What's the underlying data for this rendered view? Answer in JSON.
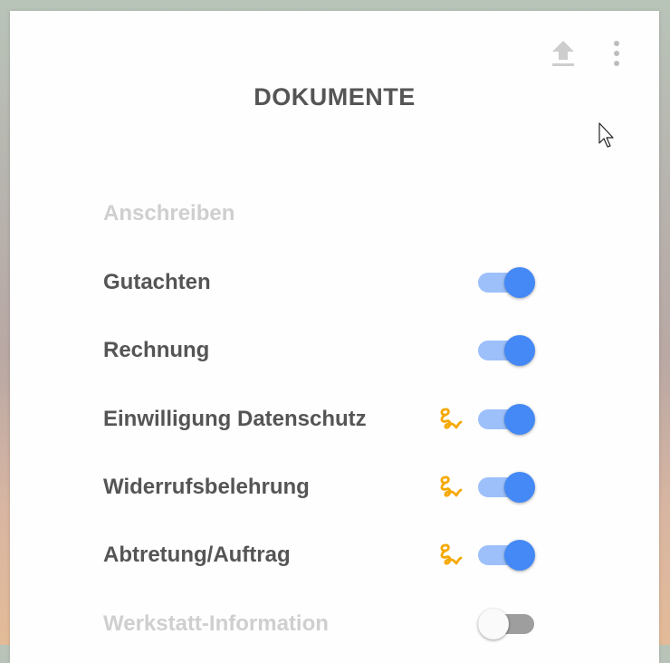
{
  "header": {
    "title": "DOKUMENTE",
    "upload_icon": "upload-icon",
    "menu_icon": "more-vert-icon"
  },
  "colors": {
    "accent": "#4489f6",
    "accent_track": "#9dc0fb",
    "sign_icon": "#f5a800",
    "text": "#555555",
    "text_disabled": "#cfcfcf"
  },
  "documents": [
    {
      "label": "Anschreiben",
      "disabled": true,
      "has_toggle": false,
      "signature": false
    },
    {
      "label": "Gutachten",
      "disabled": false,
      "has_toggle": true,
      "enabled": true,
      "signature": false
    },
    {
      "label": "Rechnung",
      "disabled": false,
      "has_toggle": true,
      "enabled": true,
      "signature": false
    },
    {
      "label": "Einwilligung Datenschutz",
      "disabled": false,
      "has_toggle": true,
      "enabled": true,
      "signature": true
    },
    {
      "label": "Widerrufsbelehrung",
      "disabled": false,
      "has_toggle": true,
      "enabled": true,
      "signature": true
    },
    {
      "label": "Abtretung/Auftrag",
      "disabled": false,
      "has_toggle": true,
      "enabled": true,
      "signature": true
    },
    {
      "label": "Werkstatt-Information",
      "disabled": true,
      "has_toggle": true,
      "enabled": false,
      "signature": false
    }
  ]
}
